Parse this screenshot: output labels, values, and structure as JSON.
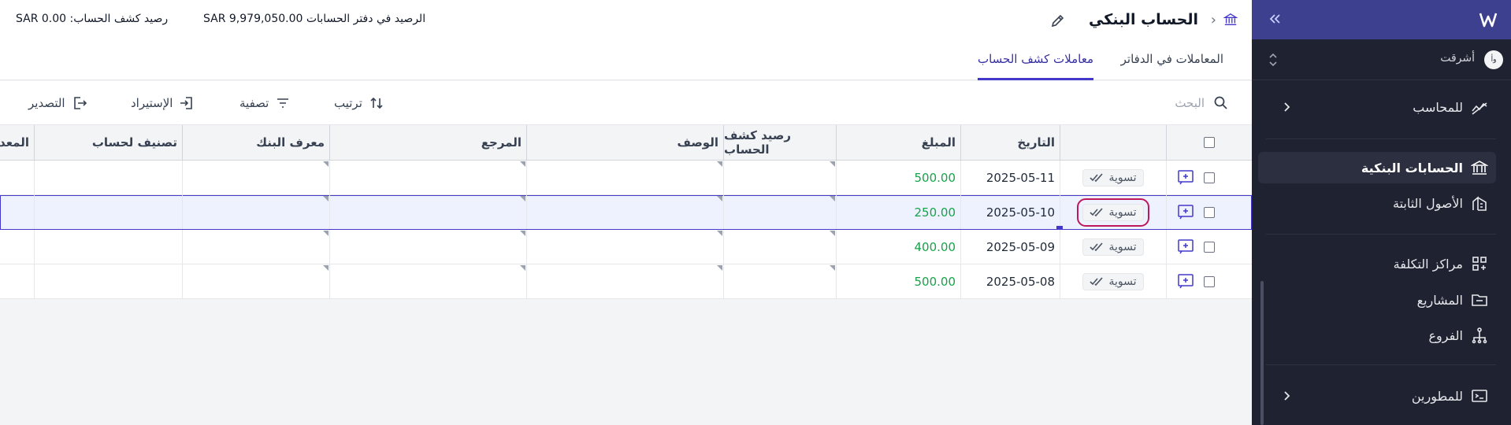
{
  "header": {
    "title": "الحساب البنكي",
    "ledger_balance": "الرصيد في دفتر الحسابات SAR 9,979,050.00",
    "statement_balance": "رصيد كشف الحساب: SAR 0.00"
  },
  "tabs": [
    {
      "label": "معاملات كشف الحساب",
      "active": true
    },
    {
      "label": "المعاملات في الدفاتر",
      "active": false
    }
  ],
  "toolbar": {
    "search_placeholder": "البحث",
    "sort_label": "ترتيب",
    "filter_label": "تصفية",
    "import_label": "الإستيراد",
    "export_label": "التصدير"
  },
  "table": {
    "columns": {
      "date": "التاريخ",
      "amount": "المبلغ",
      "statement_balance": "رصيد كشف الحساب",
      "description": "الوصف",
      "reference": "المرجع",
      "bank_id": "معرف البنك",
      "account_category": "تصنيف لحساب",
      "partial": "المعد"
    },
    "rows": [
      {
        "status": "تسوية",
        "date": "2025-05-11",
        "amount": "500.00"
      },
      {
        "status": "تسوية",
        "date": "2025-05-10",
        "amount": "250.00"
      },
      {
        "status": "تسوية",
        "date": "2025-05-09",
        "amount": "400.00"
      },
      {
        "status": "تسوية",
        "date": "2025-05-08",
        "amount": "500.00"
      }
    ]
  },
  "sidebar": {
    "org_name": "أشرقت",
    "org_avatar": "ﻭﺃ",
    "items": [
      {
        "label": "للمحاسب",
        "icon": "chart-icon"
      },
      {
        "label": "الحسابات البنكية",
        "icon": "bank-icon",
        "active": true
      },
      {
        "label": "الأصول الثابتة",
        "icon": "building-icon"
      },
      {
        "label": "مراكز التكلفة",
        "icon": "grid-icon"
      },
      {
        "label": "المشاريع",
        "icon": "folder-icon"
      },
      {
        "label": "الفروع",
        "icon": "branches-icon"
      },
      {
        "label": "للمطورين",
        "icon": "terminal-icon"
      }
    ]
  },
  "colors": {
    "accent": "#4338ca",
    "amount_green": "#16a34a",
    "sidebar_bg": "#1f2230",
    "sidebar_header": "#3d3f8f",
    "focus_ring": "#be185d"
  }
}
